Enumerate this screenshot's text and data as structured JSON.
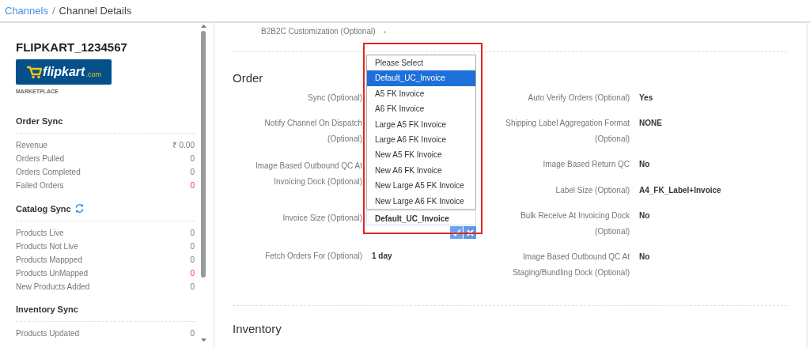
{
  "breadcrumb": {
    "items": [
      {
        "label": "Channels",
        "link": true
      },
      {
        "label": "Channel Details",
        "link": false
      }
    ],
    "separator": "/"
  },
  "sidebar": {
    "channel_name": "FLIPKART_1234567",
    "logo": {
      "text": "flipkart",
      "suffix": ".com"
    },
    "channel_type": "MARKETPLACE",
    "sections": [
      {
        "title": "Order Sync",
        "refreshable": false,
        "rows": [
          {
            "label": "Revenue",
            "value": "₹ 0.00",
            "alert": false
          },
          {
            "label": "Orders Pulled",
            "value": "0",
            "alert": false
          },
          {
            "label": "Orders Completed",
            "value": "0",
            "alert": false
          },
          {
            "label": "Failed Orders",
            "value": "0",
            "alert": true
          }
        ]
      },
      {
        "title": "Catalog Sync",
        "refreshable": true,
        "rows": [
          {
            "label": "Products Live",
            "value": "0",
            "alert": false
          },
          {
            "label": "Products Not Live",
            "value": "0",
            "alert": false
          },
          {
            "label": "Products Mappped",
            "value": "0",
            "alert": false
          },
          {
            "label": "Products UnMapped",
            "value": "0",
            "alert": true
          },
          {
            "label": "New Products Added",
            "value": "0",
            "alert": false
          }
        ]
      },
      {
        "title": "Inventory Sync",
        "refreshable": false,
        "rows": [
          {
            "label": "Products Updated",
            "value": "0",
            "alert": false
          }
        ]
      }
    ]
  },
  "top_field": {
    "label": "B2B2C Customization (Optional)",
    "value": "-"
  },
  "order": {
    "title": "Order",
    "left_fields": [
      {
        "kind": "text",
        "label": "Sync (Optional)"
      },
      {
        "kind": "text",
        "label": "Notify Channel On Dispatch (Optional)"
      },
      {
        "kind": "text",
        "label": "Image Based Outbound QC At Invoicing Dock (Optional)"
      },
      {
        "kind": "select",
        "label": "Invoice Size (Optional)",
        "value": "Default_UC_Invoice"
      },
      {
        "kind": "text",
        "label": "Fetch Orders For (Optional)",
        "value": "1 day"
      }
    ],
    "right_fields": [
      {
        "kind": "text",
        "label": "Auto Verify Orders (Optional)",
        "value": "Yes"
      },
      {
        "kind": "text",
        "label": "Shipping Label Aggregation Format (Optional)",
        "value": "NONE"
      },
      {
        "kind": "text",
        "label": "Image Based Return QC",
        "value": "No"
      },
      {
        "kind": "text",
        "label": "Label Size (Optional)",
        "value": "A4_FK_Label+Invoice"
      },
      {
        "kind": "text",
        "label": "Bulk Receive At Invoicing Dock (Optional)",
        "value": "No"
      },
      {
        "kind": "text",
        "label": "Image Based Outbound QC At Staging/Bundling Dock (Optional)",
        "value": "No"
      }
    ]
  },
  "dropdown": {
    "options": [
      {
        "label": "Please Select",
        "selected": false
      },
      {
        "label": "Default_UC_Invoice",
        "selected": true
      },
      {
        "label": "A5 FK Invoice",
        "selected": false
      },
      {
        "label": "A6 FK Invoice",
        "selected": false
      },
      {
        "label": "Large A5 FK Invoice",
        "selected": false
      },
      {
        "label": "Large A6 FK Invoice",
        "selected": false
      },
      {
        "label": "New A5 FK Invoice",
        "selected": false
      },
      {
        "label": "New A6 FK Invoice",
        "selected": false
      },
      {
        "label": "New Large A5 FK Invoice",
        "selected": false
      },
      {
        "label": "New Large A6 FK Invoice",
        "selected": false
      }
    ]
  },
  "inventory": {
    "title": "Inventory"
  }
}
